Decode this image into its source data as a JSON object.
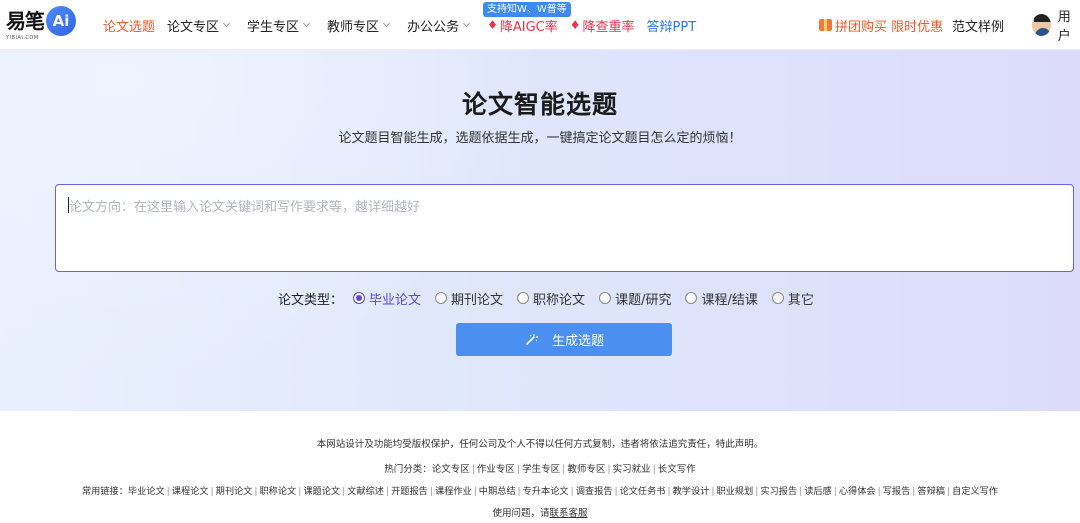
{
  "header": {
    "logo_text": "易笔",
    "logo_sub": "YIBIAI.COM",
    "logo_ai": "Ai",
    "nav": [
      {
        "label": "论文选题",
        "active": true,
        "dropdown": false
      },
      {
        "label": "论文专区",
        "active": false,
        "dropdown": true
      },
      {
        "label": "学生专区",
        "active": false,
        "dropdown": true
      },
      {
        "label": "教师专区",
        "active": false,
        "dropdown": true
      },
      {
        "label": "办公公务",
        "active": false,
        "dropdown": true
      }
    ],
    "badge": "支持知W、W普等",
    "promo_links": [
      {
        "label": "降AIGC率",
        "icon": "fire-icon",
        "color": "#e8334a"
      },
      {
        "label": "降查重率",
        "icon": "fire-icon",
        "color": "#e8334a"
      },
      {
        "label": "答辩PPT",
        "icon": "",
        "color": "#2a78e8"
      }
    ],
    "group_buy": "拼团购买 限时优惠",
    "samples": "范文样例",
    "user": "用户"
  },
  "hero": {
    "title": "论文智能选题",
    "subtitle": "论文题目智能生成，选题依据生成，一键搞定论文题目怎么定的烦恼！",
    "input_placeholder": "论文方向：在这里输入论文关键词和写作要求等，越详细越好",
    "type_label": "论文类型：",
    "types": [
      {
        "label": "毕业论文",
        "checked": true
      },
      {
        "label": "期刊论文",
        "checked": false
      },
      {
        "label": "职称论文",
        "checked": false
      },
      {
        "label": "课题/研究",
        "checked": false
      },
      {
        "label": "课程/结课",
        "checked": false
      },
      {
        "label": "其它",
        "checked": false
      }
    ],
    "generate_button": "生成选题"
  },
  "footer": {
    "copyright": "本网站设计及功能均受版权保护，任何公司及个人不得以任何方式复制，违者将依法追究责任，特此声明。",
    "hot_label": "热门分类：",
    "hot": [
      "论文专区",
      "作业专区",
      "学生专区",
      "教师专区",
      "实习就业",
      "长文写作"
    ],
    "common_label": "常用链接：",
    "common": [
      "毕业论文",
      "课程论文",
      "期刊论文",
      "职称论文",
      "课题论文",
      "文献综述",
      "开题报告",
      "课程作业",
      "中期总结",
      "专升本论文",
      "调查报告",
      "论文任务书",
      "教学设计",
      "职业规划",
      "实习报告",
      "读后感",
      "心得体会",
      "写报告",
      "答辩稿",
      "自定义写作"
    ],
    "help_text": "使用问题，请",
    "help_link": "联系客服"
  },
  "colors": {
    "accent": "#f05a28",
    "primary_button": "#4b8ff0",
    "radio_checked": "#5b48e0",
    "input_border": "#6a60e6"
  }
}
